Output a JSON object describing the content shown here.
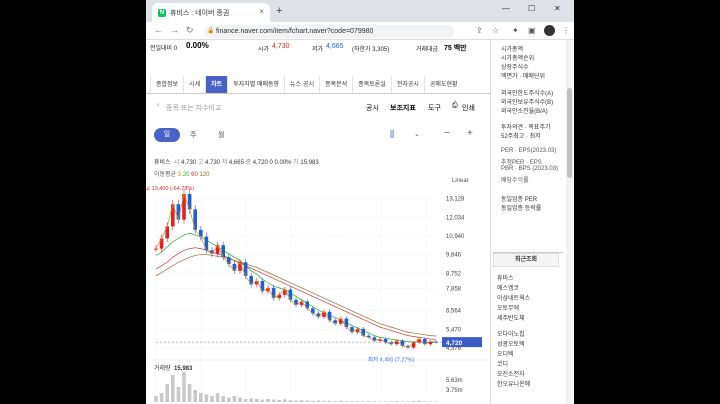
{
  "browser": {
    "tab_title": "휴비스 : 네이버 증권",
    "tab_close": "×",
    "new_tab": "+",
    "url": "finance.naver.com/item/fchart.naver?code=079980",
    "win_min": "—",
    "win_max": "☐",
    "win_close": "✕",
    "back": "←",
    "forward": "→",
    "reload": "↻",
    "avatar_letter": "●"
  },
  "stock_header": {
    "prev_label": "전일대비 0",
    "change": "0.00%",
    "high_label": "시가",
    "high": "4,730",
    "low_label": "저가",
    "low": "4,665",
    "low_limit": "(하한가 3,305)",
    "amount_label": "거래대금",
    "amount": "75 백만"
  },
  "tabs": [
    "종합정보",
    "시세",
    "차트",
    "투자자별 매매동향",
    "뉴스·공시",
    "종목분석",
    "종목토론실",
    "전자공시",
    "공매도현황"
  ],
  "search": {
    "placeholder": "종목 또는 지수비교",
    "links": [
      "공시",
      "보조지표",
      "도구",
      "인쇄"
    ]
  },
  "period": {
    "day": "일",
    "week": "주",
    "month": "월"
  },
  "info_line": {
    "name": "휴비스",
    "open_l": "시",
    "open": "4,730",
    "high_l": "고",
    "high": "4,730",
    "low_l": "저",
    "low": "4,665",
    "close_l": "종",
    "close": "4,720",
    "chg": "0 0.00%",
    "vol_l": "거",
    "vol": "15,983"
  },
  "ma_line": {
    "label": "이동평균",
    "p5": "5",
    "p20": "20",
    "p60": "60",
    "p120": "120"
  },
  "chart_data": {
    "type": "line",
    "scale": "Linear",
    "y_ticks": [
      "13,128",
      "12,034",
      "10,940",
      "9,846",
      "8,752",
      "7,858",
      "6,564",
      "5,470",
      "4,376"
    ],
    "max_label": "최고 13,400 (-64.78%)",
    "min_label": "최저 4,400 (7.27%)",
    "current": "4,720",
    "volume_label": "거래량",
    "volume": "15,983",
    "vol_ticks": [
      "5.63m",
      "3.75m"
    ],
    "close": [
      10200,
      10800,
      11500,
      12800,
      11900,
      13400,
      12500,
      11300,
      10900,
      10100,
      9900,
      10400,
      9700,
      9300,
      8900,
      9400,
      8600,
      8100,
      8300,
      7700,
      7900,
      7300,
      7500,
      7800,
      7200,
      6900,
      7100,
      6700,
      6400,
      6200,
      6500,
      6000,
      5800,
      6100,
      5600,
      5300,
      5500,
      5100,
      5000,
      4800,
      4900,
      4700,
      4600,
      4800,
      4500,
      4400,
      4700,
      4900,
      4600,
      4750,
      4720
    ],
    "ma20": [
      9800,
      10000,
      10300,
      10600,
      10800,
      11000,
      11100,
      11000,
      10900,
      10700,
      10500,
      10300,
      10100,
      9900,
      9700,
      9500,
      9200,
      8900,
      8700,
      8400,
      8200,
      8000,
      7900,
      7800,
      7600,
      7400,
      7200,
      7000,
      6800,
      6600,
      6450,
      6300,
      6150,
      6000,
      5850,
      5700,
      5550,
      5400,
      5250,
      5100,
      5000,
      4950,
      4900,
      4850,
      4800,
      4750,
      4720,
      4720,
      4710,
      4700,
      4700
    ],
    "ma60": [
      9000,
      9200,
      9400,
      9700,
      9900,
      10100,
      10200,
      10250,
      10200,
      10100,
      10000,
      9900,
      9800,
      9650,
      9500,
      9350,
      9200,
      9050,
      8900,
      8750,
      8600,
      8450,
      8300,
      8150,
      8000,
      7850,
      7700,
      7550,
      7400,
      7250,
      7100,
      6950,
      6800,
      6650,
      6500,
      6350,
      6200,
      6050,
      5900,
      5750,
      5600,
      5500,
      5400,
      5300,
      5200,
      5100,
      5050,
      5000,
      4950,
      4900,
      4880
    ],
    "ma120": [
      8600,
      8800,
      9000,
      9200,
      9400,
      9550,
      9700,
      9800,
      9850,
      9850,
      9800,
      9750,
      9700,
      9600,
      9500,
      9400,
      9300,
      9200,
      9100,
      8950,
      8800,
      8650,
      8500,
      8350,
      8200,
      8050,
      7900,
      7750,
      7600,
      7450,
      7300,
      7150,
      7000,
      6850,
      6700,
      6550,
      6400,
      6250,
      6100,
      5950,
      5800,
      5700,
      5600,
      5500,
      5400,
      5300,
      5250,
      5200,
      5150,
      5100,
      5080
    ],
    "volume_bars": [
      0.2,
      0.3,
      0.6,
      0.9,
      0.5,
      1.0,
      0.6,
      0.4,
      0.3,
      0.25,
      0.2,
      0.3,
      0.2,
      0.15,
      0.2,
      0.15,
      0.1,
      0.12,
      0.1,
      0.08,
      0.1,
      0.08,
      0.07,
      0.09,
      0.06,
      0.05,
      0.06,
      0.05,
      0.04,
      0.05,
      0.04,
      0.04,
      0.03,
      0.04,
      0.03,
      0.03,
      0.03,
      0.02,
      0.03,
      0.02,
      0.02,
      0.02,
      0.02,
      0.03,
      0.02,
      0.02,
      0.03,
      0.04,
      0.02,
      0.02,
      0.02
    ],
    "ylim": [
      4376,
      13400
    ],
    "colors": {
      "up": "#e22020",
      "down": "#1f5fd0",
      "ma5": "#d98b1f",
      "ma20": "#2aa52a",
      "ma60": "#d03a3a",
      "ma120": "#9a6a2a",
      "current_tag": "#3b5bc7"
    }
  },
  "sidebar": {
    "lines_top": [
      "시가총액",
      "시가총액순위",
      "상장주식수",
      "액면가 · 매매단위"
    ],
    "lines_mid": [
      "외국인한도주식수(A)",
      "외국인보유주식수(B)",
      "외국인소진율(B/A)"
    ],
    "lines_invest": [
      "투자의견 · 목표주가",
      "52주최고 · 최저"
    ],
    "lines_per": [
      "PER · EPS(2023.03)",
      "추정PER · EPS",
      "PBR · BPS (2023.03)",
      "배당수익률"
    ],
    "lines_same": [
      "동일업종 PER",
      "동일업종 등락률"
    ],
    "recent_title": "최근조회",
    "recent_items": [
      "휴비스",
      "에스엠코",
      "이삼네트웍스",
      "오토무에",
      "세주반도체",
      "오다이노칩",
      "성광오토텍",
      "오디텍",
      "코디",
      "오진소전자",
      "한오유니온메"
    ]
  }
}
